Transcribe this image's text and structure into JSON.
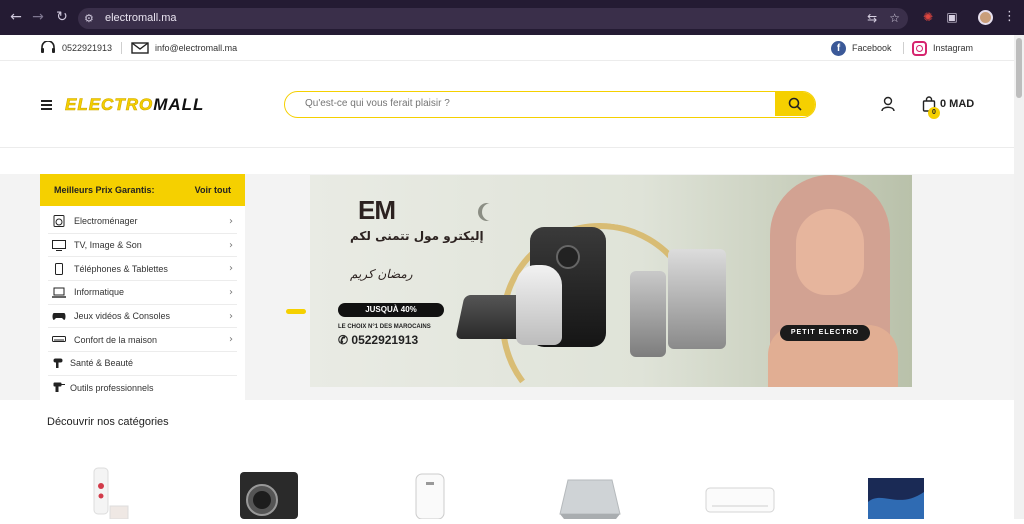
{
  "browser": {
    "url": "electromall.ma"
  },
  "topbar": {
    "phone": "0522921913",
    "email": "info@electromall.ma",
    "facebook": "Facebook",
    "instagram": "Instagram"
  },
  "header": {
    "logo_part1": "ELECTRO",
    "logo_part2": "MALL",
    "search_placeholder": "Qu'est-ce qui vous ferait plaisir ?",
    "cart_count": "0",
    "cart_total": "0 MAD"
  },
  "categories_menu": {
    "title": "Meilleurs Prix Garantis:",
    "see_all": "Voir tout",
    "items": [
      {
        "label": "Electroménager",
        "icon": "washer-icon",
        "has_submenu": true
      },
      {
        "label": "TV, Image & Son",
        "icon": "tv-icon",
        "has_submenu": true
      },
      {
        "label": "Téléphones & Tablettes",
        "icon": "phone-icon",
        "has_submenu": true
      },
      {
        "label": "Informatique",
        "icon": "laptop-icon",
        "has_submenu": true
      },
      {
        "label": "Jeux vidéos & Consoles",
        "icon": "gamepad-icon",
        "has_submenu": true
      },
      {
        "label": "Confort de la maison",
        "icon": "air-conditioner-icon",
        "has_submenu": true
      },
      {
        "label": "Santé & Beauté",
        "icon": "hair-dryer-icon",
        "has_submenu": false
      },
      {
        "label": "Outils professionnels",
        "icon": "drill-icon",
        "has_submenu": false
      }
    ]
  },
  "banner": {
    "brand": "EM",
    "arabic_line": "إليكترو مول تتمنى لكم",
    "arabic_greeting": "رمضان كريم",
    "promo": "JUSQUÀ 40%",
    "tagline": "LE CHOIX N°1 DES MAROCAINS",
    "phone": "0522921913",
    "badge": "PETIT ELECTRO",
    "slides": 3,
    "active_slide": 1
  },
  "discover": {
    "title": "Découvrir nos catégories"
  },
  "colors": {
    "accent": "#f5d000",
    "chrome": "#241b33"
  }
}
